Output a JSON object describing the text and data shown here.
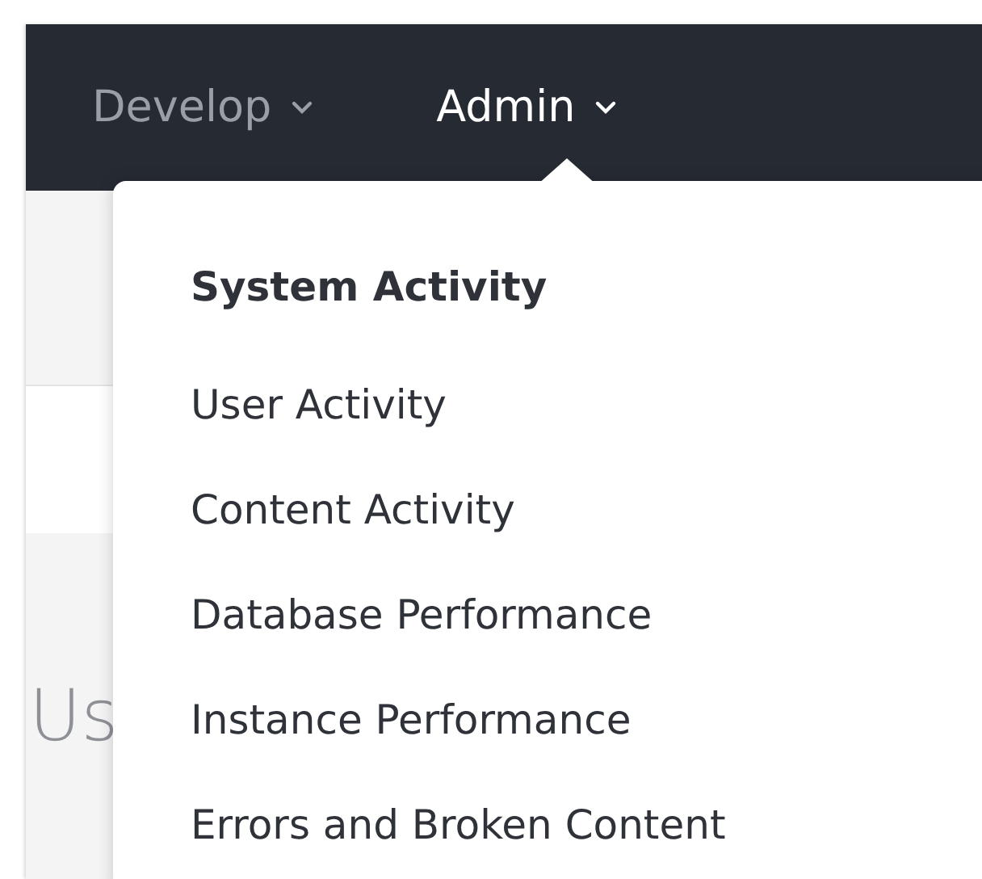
{
  "nav": {
    "items": [
      {
        "label": "Develop",
        "selected": false
      },
      {
        "label": "Admin",
        "selected": true
      }
    ]
  },
  "page": {
    "heading": "Us"
  },
  "dropdown": {
    "items": [
      {
        "kind": "heading",
        "label": "System Activity"
      },
      {
        "kind": "link",
        "label": "User Activity"
      },
      {
        "kind": "link",
        "label": "Content Activity"
      },
      {
        "kind": "link",
        "label": "Database Performance"
      },
      {
        "kind": "link",
        "label": "Instance Performance"
      },
      {
        "kind": "link",
        "label": "Errors and Broken Content"
      }
    ]
  }
}
